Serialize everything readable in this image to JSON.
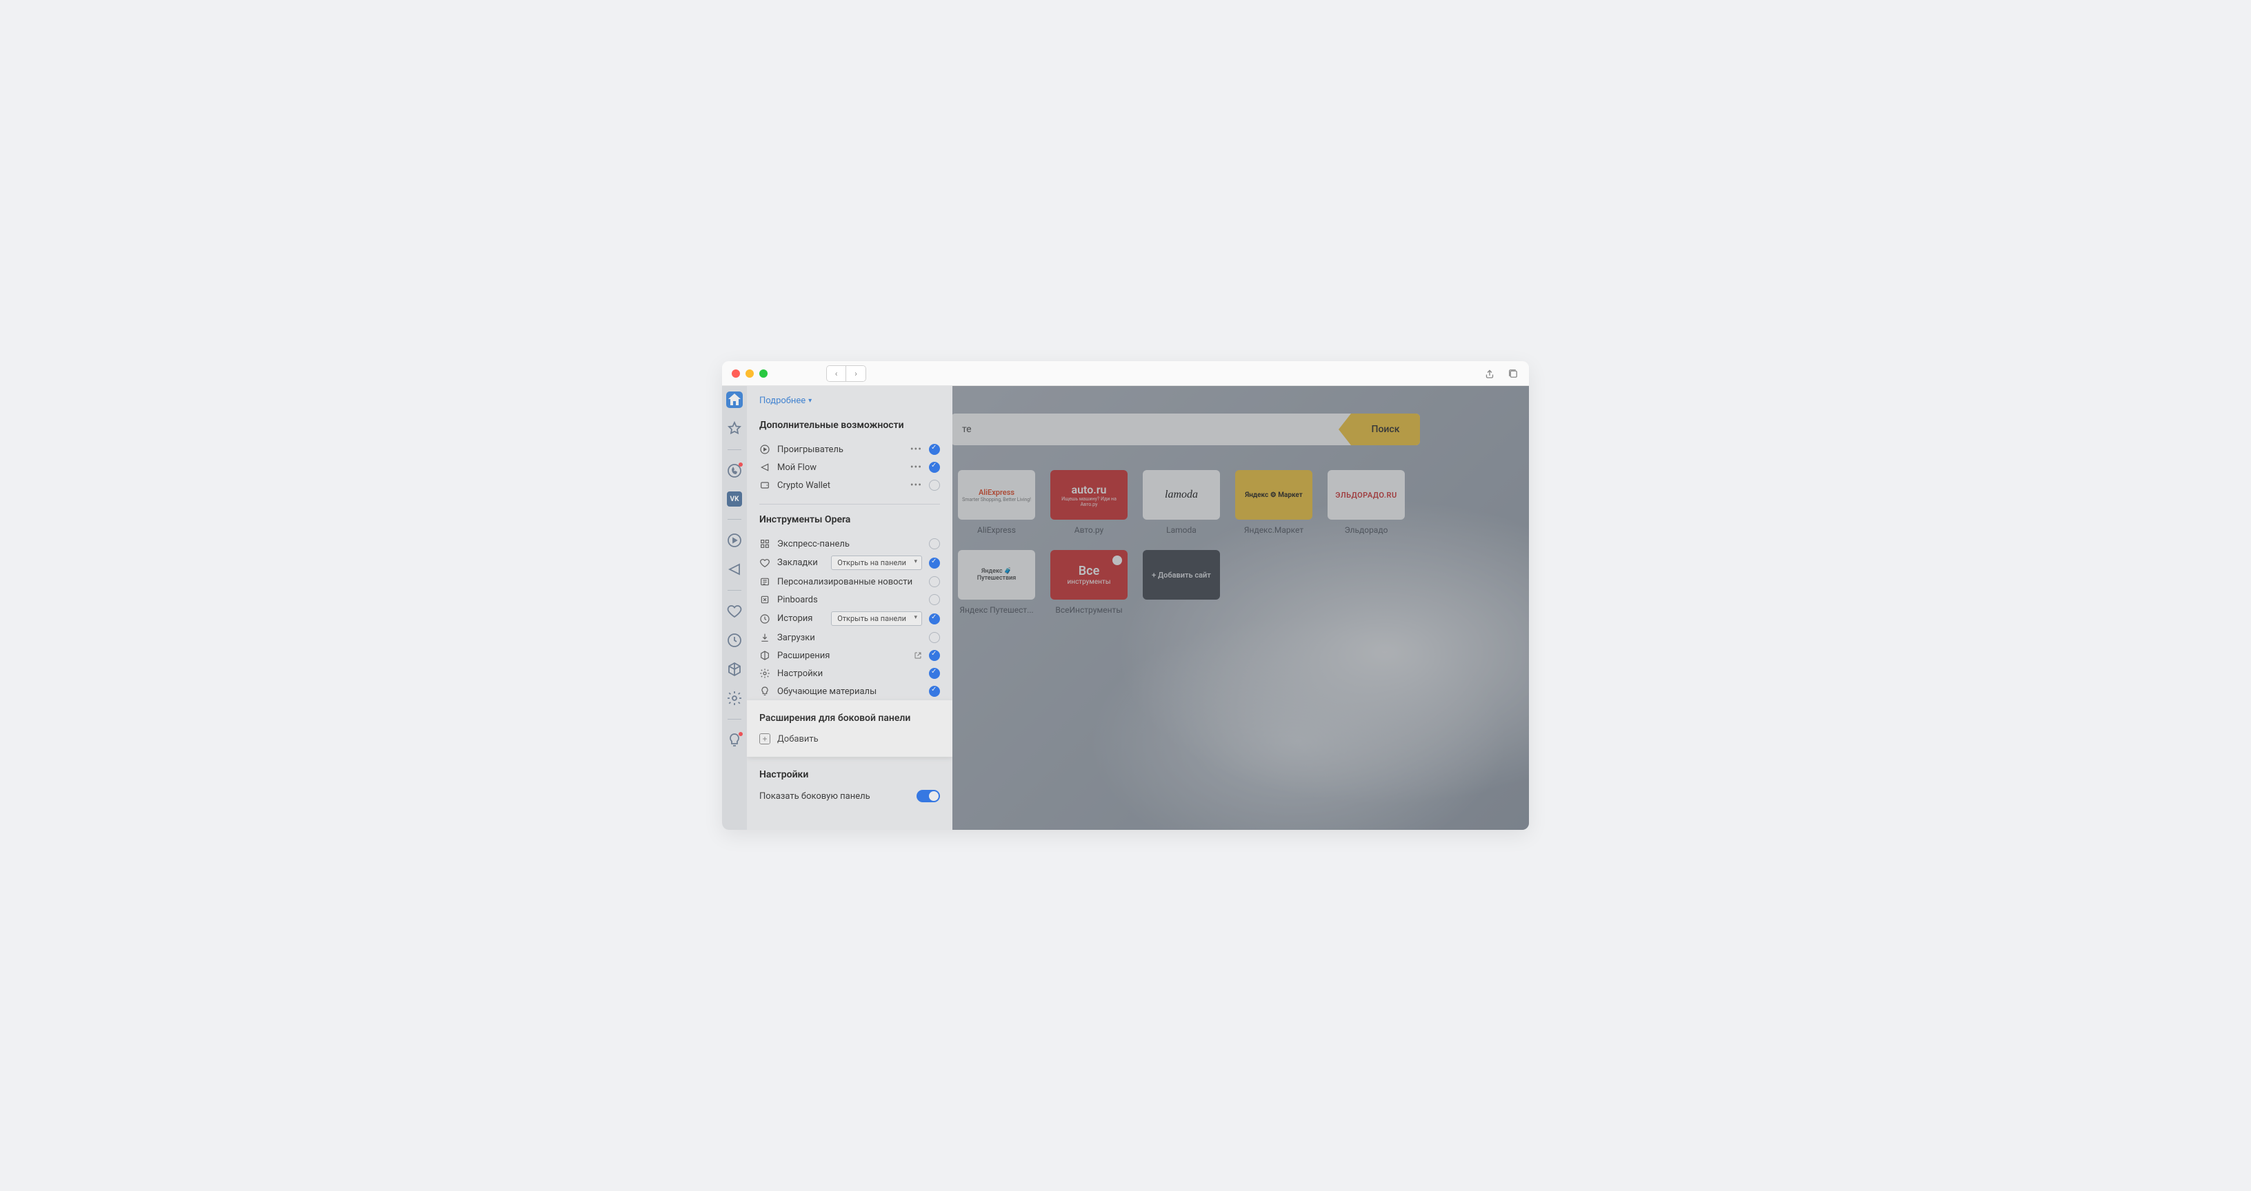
{
  "titlebar": {
    "nav_back": "‹",
    "nav_forward": "›"
  },
  "panel": {
    "more": "Подробнее",
    "section_extras": "Дополнительные возможности",
    "extras": [
      {
        "label": "Проигрыватель",
        "checked": true,
        "dots": true
      },
      {
        "label": "Мой Flow",
        "checked": true,
        "dots": true
      },
      {
        "label": "Crypto Wallet",
        "checked": false,
        "dots": true
      }
    ],
    "section_tools": "Инструменты Opera",
    "open_panel": "Открыть на панели",
    "tools": {
      "express": "Экспресс-панель",
      "bookmarks": "Закладки",
      "news": "Персонализированные новости",
      "pinboards": "Pinboards",
      "history": "История",
      "downloads": "Загрузки",
      "extensions": "Расширения",
      "settings": "Настройки",
      "learning": "Обучающие материалы"
    },
    "section_ext_panel": "Расширения для боковой панели",
    "add": "Добавить",
    "section_settings": "Настройки",
    "show_sidebar": "Показать боковую панель"
  },
  "speeddial": {
    "search_placeholder": "те",
    "search_btn": "Поиск",
    "tiles": [
      {
        "label": "AliExpress",
        "logo": "AliExpress",
        "sub": "Smarter Shopping, Better Living!"
      },
      {
        "label": "Авто.ру",
        "logo": "auto.ru",
        "sub": "Ищешь машину? Иди на Авто.ру"
      },
      {
        "label": "Lamoda",
        "logo": "lamoda"
      },
      {
        "label": "Яндекс.Маркет",
        "logo": "Яндекс ⚙ Маркет"
      },
      {
        "label": "Эльдорадо",
        "logo": "ЭЛЬДОРАДО.RU"
      },
      {
        "label": "Яндекс Путешест...",
        "logo": "Яндекс 🧳 Путешествия"
      },
      {
        "label": "ВсеИнструменты",
        "logo": "Все",
        "sub": "инструменты"
      },
      {
        "label": "",
        "logo": "+ Добавить сайт"
      }
    ]
  }
}
